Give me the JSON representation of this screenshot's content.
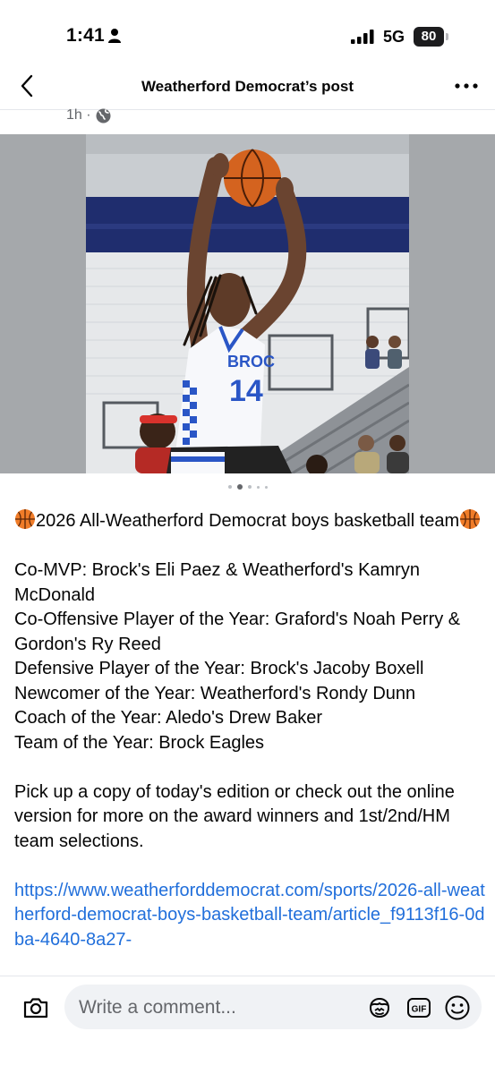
{
  "status_bar": {
    "time": "1:41",
    "network": "5G",
    "battery": "80"
  },
  "header": {
    "title": "Weatherford Democrat’s post"
  },
  "post": {
    "time_ago": "1h ·",
    "photo": {
      "jersey_text": "BROC",
      "jersey_number": "14"
    },
    "carousel": {
      "count": 5,
      "active_index": 1
    },
    "headline": "2026 All-Weatherford Democrat boys basketball team",
    "awards": [
      "Co-MVP: Brock's Eli Paez & Weatherford's Kamryn McDonald",
      "Co-Offensive Player of the Year: Graford's Noah Perry & Gordon's Ry Reed",
      "Defensive Player of the Year: Brock's Jacoby Boxell",
      "Newcomer of the Year: Weatherford's Rondy Dunn",
      "Coach of the Year: Aledo's Drew Baker",
      "Team of the Year: Brock Eagles"
    ],
    "cta": "Pick up a copy of today's edition or check out the online version for more on the award winners and 1st/2nd/HM team selections.",
    "link": "https://www.weatherforddemocrat.com/sports/2026-all-weatherford-democrat-boys-basketball-team/article_f9113f16-0dba-4640-8a27-"
  },
  "comment_bar": {
    "placeholder": "Write a comment...",
    "gif_label": "GIF"
  },
  "icons": {
    "emoji": "basketball-emoji",
    "accent_link": "#216fdb"
  }
}
